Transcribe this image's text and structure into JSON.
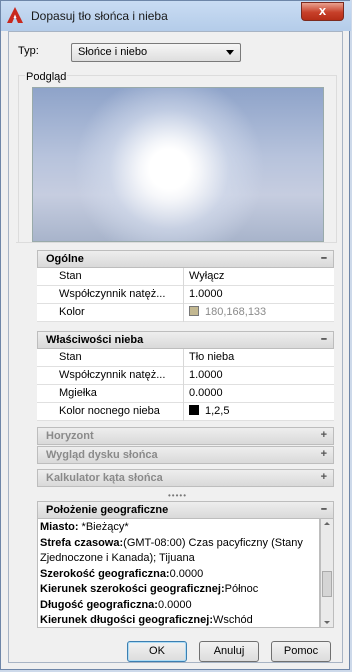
{
  "window": {
    "title": "Dopasuj tło słońca i nieba",
    "close_glyph": "x"
  },
  "type": {
    "label": "Typ:",
    "value": "Słońce i niebo"
  },
  "preview": {
    "label": "Podgląd"
  },
  "sections": {
    "general": {
      "title": "Ogólne",
      "sign": "–",
      "rows": [
        {
          "key": "Stan",
          "value": "Wyłącz"
        },
        {
          "key": "Współczynnik natęż...",
          "value": "1.0000"
        },
        {
          "key": "Kolor",
          "value": "180,168,133",
          "swatch": "#c3b891"
        }
      ]
    },
    "sky": {
      "title": "Właściwości nieba",
      "sign": "–",
      "rows": [
        {
          "key": "Stan",
          "value": "Tło nieba"
        },
        {
          "key": "Współczynnik natęż...",
          "value": "1.0000"
        },
        {
          "key": "Mgiełka",
          "value": "0.0000"
        },
        {
          "key": "Kolor nocnego nieba",
          "value": "1,2,5",
          "swatch": "#000000"
        }
      ]
    },
    "horizon": {
      "title": "Horyzont",
      "sign": "+"
    },
    "sundisk": {
      "title": "Wygląd dysku słońca",
      "sign": "+"
    },
    "calc": {
      "title": "Kalkulator kąta słońca",
      "sign": "+"
    },
    "geo": {
      "title": "Położenie geograficzne",
      "sign": "–"
    }
  },
  "geo_lines": [
    {
      "k": "Miasto:",
      "v": " *Bieżący*"
    },
    {
      "k": "Strefa czasowa:",
      "v": "(GMT-08:00) Czas pacyficzny (Stany"
    },
    {
      "k": "",
      "v": "Zjednoczone i Kanada); Tijuana"
    },
    {
      "k": "Szerokość geograficzna:",
      "v": "0.0000"
    },
    {
      "k": "Kierunek szerokości geograficznej:",
      "v": "Północ"
    },
    {
      "k": "Długość geograficzna:",
      "v": "0.0000"
    },
    {
      "k": "Kierunek długości geograficznej:",
      "v": "Wschód"
    }
  ],
  "buttons": {
    "ok": "OK",
    "cancel": "Anuluj",
    "help": "Pomoc"
  },
  "grip": "•••••"
}
